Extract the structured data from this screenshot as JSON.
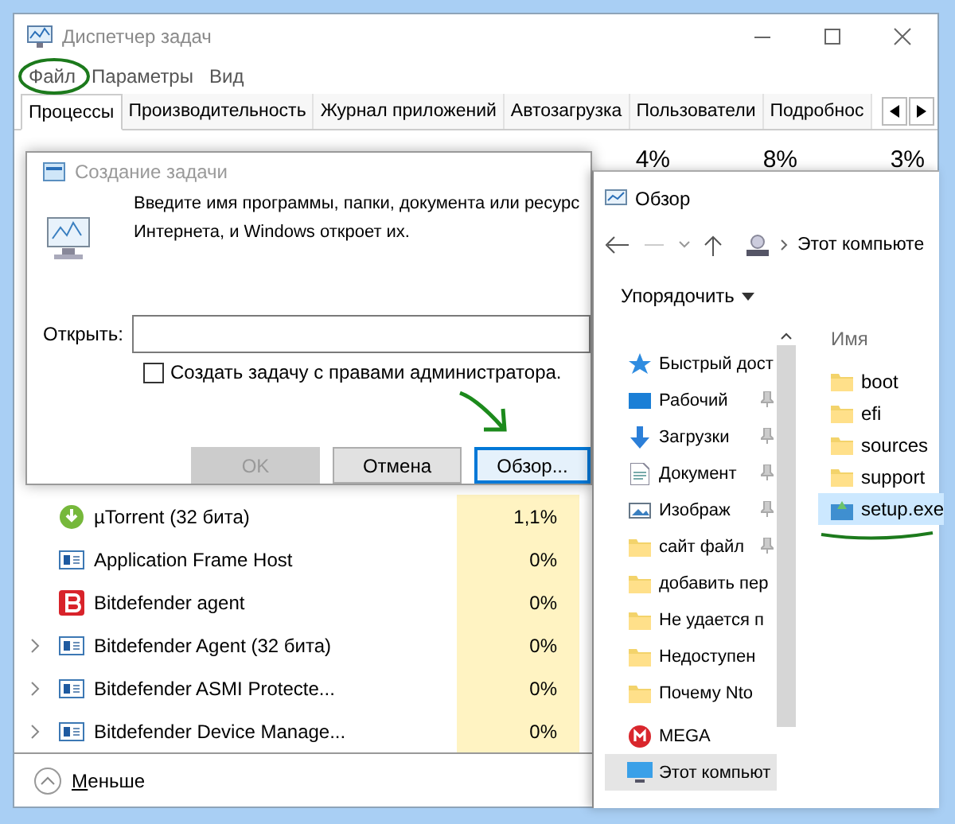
{
  "task_manager": {
    "title": "Диспетчер задач",
    "menu": [
      "Файл",
      "Параметры",
      "Вид"
    ],
    "tabs": [
      {
        "label": "Процессы",
        "selected": true
      },
      {
        "label": "Производительность",
        "selected": false
      },
      {
        "label": "Журнал приложений",
        "selected": false
      },
      {
        "label": "Автозагрузка",
        "selected": false
      },
      {
        "label": "Пользователи",
        "selected": false
      },
      {
        "label": "Подробнос",
        "selected": false
      }
    ],
    "usage": [
      "4%",
      "8%",
      "3%"
    ],
    "processes": [
      {
        "name": "µTorrent (32 бита)",
        "cpu": "1,1%",
        "kind": "torrent",
        "expandable": false
      },
      {
        "name": "Application Frame Host",
        "cpu": "0%",
        "kind": "app",
        "expandable": false
      },
      {
        "name": "Bitdefender agent",
        "cpu": "0%",
        "kind": "shield",
        "expandable": false
      },
      {
        "name": "Bitdefender Agent (32 бита)",
        "cpu": "0%",
        "kind": "app",
        "expandable": true
      },
      {
        "name": "Bitdefender ASMI Protecte...",
        "cpu": "0%",
        "kind": "app",
        "expandable": true
      },
      {
        "name": "Bitdefender Device Manage...",
        "cpu": "0%",
        "kind": "app",
        "expandable": true
      }
    ],
    "fewer_details": "Меньше"
  },
  "create_task": {
    "title": "Создание задачи",
    "prompt_lines": [
      "Введите имя программы, папки, документа или ресурс",
      "Интернета, и Windows откроет их."
    ],
    "open_label": "Открыть:",
    "admin_checkbox": {
      "label": "Создать задачу с правами администратора.",
      "checked": false
    },
    "buttons": [
      {
        "label": "OK",
        "disabled": true,
        "focused": false
      },
      {
        "label": "Отмена",
        "disabled": false,
        "focused": false
      },
      {
        "label": "Обзор...",
        "disabled": false,
        "focused": true
      }
    ]
  },
  "browse": {
    "title": "Обзор",
    "path": "Этот компьюте",
    "organize": "Упорядочить",
    "column": "Имя",
    "nav": [
      {
        "label": "Быстрый дост",
        "kind": "star",
        "pinned": false,
        "selected": false
      },
      {
        "label": "Рабочий",
        "kind": "desktop",
        "pinned": true,
        "selected": false
      },
      {
        "label": "Загрузки",
        "kind": "download",
        "pinned": true,
        "selected": false
      },
      {
        "label": "Документ",
        "kind": "document",
        "pinned": true,
        "selected": false
      },
      {
        "label": "Изображ",
        "kind": "pictures",
        "pinned": true,
        "selected": false
      },
      {
        "label": "сайт файл",
        "kind": "folder",
        "pinned": true,
        "selected": false
      },
      {
        "label": "добавить пер",
        "kind": "folder",
        "pinned": false,
        "selected": false
      },
      {
        "label": "Не удается п",
        "kind": "folder",
        "pinned": false,
        "selected": false
      },
      {
        "label": "Недоступен",
        "kind": "folder",
        "pinned": false,
        "selected": false
      },
      {
        "label": "Почему Nto",
        "kind": "folder",
        "pinned": false,
        "selected": false
      },
      {
        "label": "MEGA",
        "kind": "mega",
        "pinned": false,
        "selected": false
      },
      {
        "label": "Этот компьют",
        "kind": "computer",
        "pinned": false,
        "selected": true
      }
    ],
    "files": [
      {
        "name": "boot",
        "kind": "folder",
        "selected": false
      },
      {
        "name": "efi",
        "kind": "folder",
        "selected": false
      },
      {
        "name": "sources",
        "kind": "folder",
        "selected": false
      },
      {
        "name": "support",
        "kind": "folder",
        "selected": false
      },
      {
        "name": "setup.exe",
        "kind": "exe",
        "selected": true
      }
    ]
  }
}
